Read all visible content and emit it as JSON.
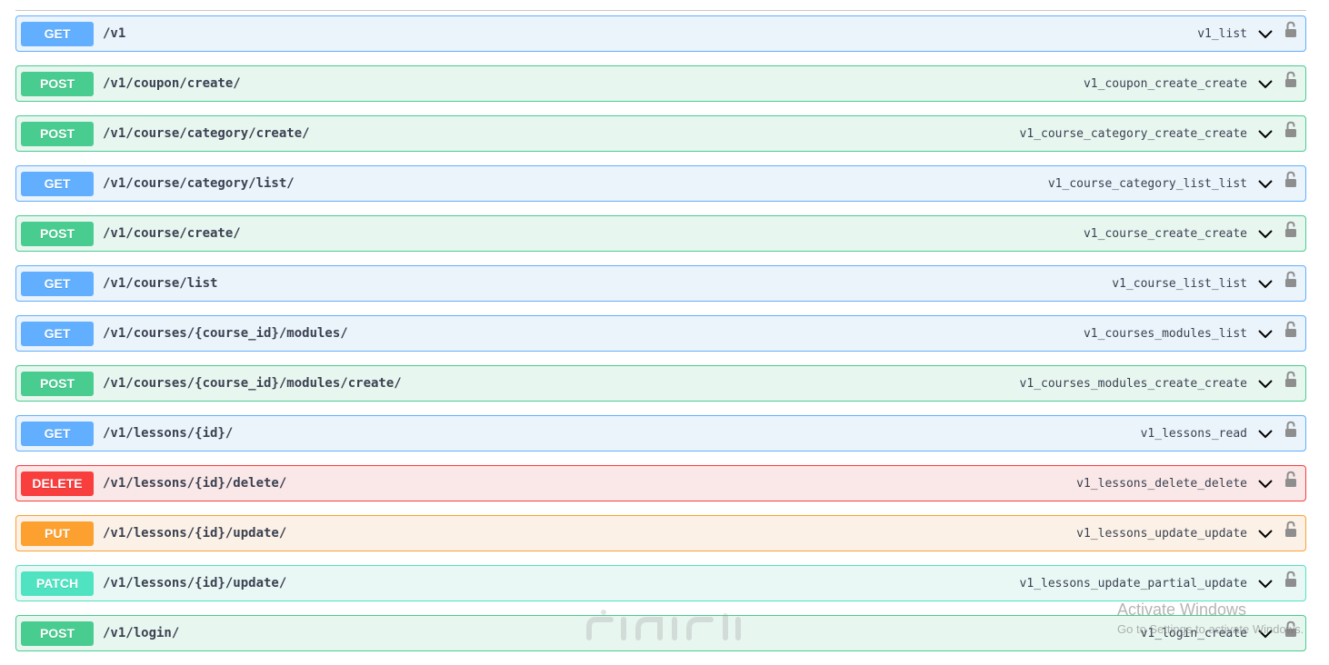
{
  "operations": [
    {
      "method": "GET",
      "path": "/v1",
      "operation_id": "v1_list"
    },
    {
      "method": "POST",
      "path": "/v1/coupon/create/",
      "operation_id": "v1_coupon_create_create"
    },
    {
      "method": "POST",
      "path": "/v1/course/category/create/",
      "operation_id": "v1_course_category_create_create"
    },
    {
      "method": "GET",
      "path": "/v1/course/category/list/",
      "operation_id": "v1_course_category_list_list"
    },
    {
      "method": "POST",
      "path": "/v1/course/create/",
      "operation_id": "v1_course_create_create"
    },
    {
      "method": "GET",
      "path": "/v1/course/list",
      "operation_id": "v1_course_list_list"
    },
    {
      "method": "GET",
      "path": "/v1/courses/{course_id}/modules/",
      "operation_id": "v1_courses_modules_list"
    },
    {
      "method": "POST",
      "path": "/v1/courses/{course_id}/modules/create/",
      "operation_id": "v1_courses_modules_create_create"
    },
    {
      "method": "GET",
      "path": "/v1/lessons/{id}/",
      "operation_id": "v1_lessons_read"
    },
    {
      "method": "DELETE",
      "path": "/v1/lessons/{id}/delete/",
      "operation_id": "v1_lessons_delete_delete"
    },
    {
      "method": "PUT",
      "path": "/v1/lessons/{id}/update/",
      "operation_id": "v1_lessons_update_update"
    },
    {
      "method": "PATCH",
      "path": "/v1/lessons/{id}/update/",
      "operation_id": "v1_lessons_update_partial_update"
    },
    {
      "method": "POST",
      "path": "/v1/login/",
      "operation_id": "v1_login_create"
    }
  ],
  "icons": {
    "expand": "chevron-down-icon",
    "auth": "lock-icon"
  },
  "colors": {
    "get": "#61affe",
    "post": "#49cc90",
    "delete": "#f93e3e",
    "put": "#fca130",
    "patch": "#50e3c2",
    "text": "#3b4151"
  },
  "watermark": {
    "line1": "Activate Windows",
    "line2": "Go to Settings to activate Windows."
  }
}
